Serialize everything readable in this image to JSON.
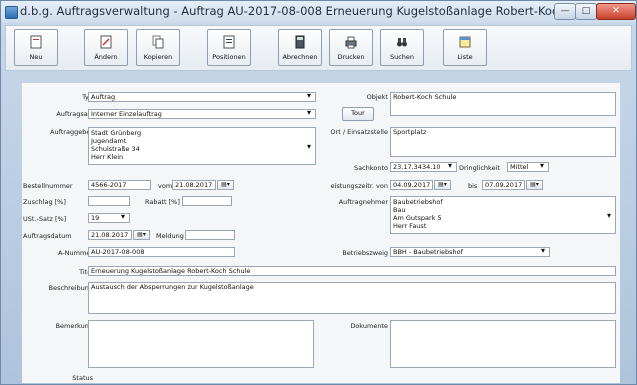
{
  "window": {
    "title": "d.b.g.  Auftragsverwaltung  -  Auftrag  AU-2017-08-008  Erneuerung Kugelstoßanlage Robert-Koch Schule",
    "btn_minimize": "—",
    "btn_maximize": "□",
    "btn_close": "✕"
  },
  "toolbar": {
    "buttons": [
      {
        "label": "Neu",
        "icon": "document-new-icon"
      },
      {
        "label": "Ändern",
        "icon": "document-edit-icon"
      },
      {
        "label": "Kopieren",
        "icon": "copy-icon"
      },
      {
        "label": "Positionen",
        "icon": "list-icon"
      },
      {
        "label": "Abrechnen",
        "icon": "calculator-icon"
      },
      {
        "label": "Drucken",
        "icon": "printer-icon"
      },
      {
        "label": "Suchen",
        "icon": "binoculars-icon"
      },
      {
        "label": "Liste",
        "icon": "table-icon"
      }
    ]
  },
  "form": {
    "typ": {
      "label": "Typ",
      "value": "Auftrag"
    },
    "auftragsart": {
      "label": "Auftragsart",
      "value": "Interner Einzelauftrag"
    },
    "auftraggeber": {
      "label": "Auftraggeber",
      "line1": "Stadt Grünberg",
      "line2": "Jugendamt",
      "line3": "Schulstraße 34",
      "line4": "Herr Klein"
    },
    "objekt": {
      "label": "Objekt",
      "value": "Robert-Koch Schule"
    },
    "tour": {
      "label": "Tour"
    },
    "ort": {
      "label": "Ort / Einsatzstelle",
      "value": "Sportplatz"
    },
    "sachkonto": {
      "label": "Sachkonto",
      "value": "23.17.3434.10"
    },
    "dringlichkeit": {
      "label": "Dringlichkeit",
      "value": "Mittel"
    },
    "bestellnummer": {
      "label": "Bestellnummer",
      "value": "4566-2017"
    },
    "vom": {
      "label": "vom",
      "value": "21.08.2017"
    },
    "leistungszeitraum": {
      "label": "eistungszeitr. von",
      "value": "04.09.2017"
    },
    "bis": {
      "label": "bis",
      "value": "07.09.2017"
    },
    "zuschlag": {
      "label": "Zuschlag [%]",
      "value": ""
    },
    "rabatt": {
      "label": "Rabatt [%]",
      "value": ""
    },
    "auftragnehmer": {
      "label": "Auftragnehmer",
      "line1": "Baubetriebshof",
      "line2": "Bau",
      "line3": "Am Gutspark 5",
      "line4": "Herr Faust"
    },
    "ust": {
      "label": "USt.-Satz [%]",
      "value": "19"
    },
    "auftragsdatum": {
      "label": "Auftragsdatum",
      "value": "21.08.2017"
    },
    "meldung": {
      "label": "Meldung",
      "value": ""
    },
    "anummer": {
      "label": "A-Nummer",
      "value": "AU-2017-08-008"
    },
    "betriebszweig": {
      "label": "Betriebszweig",
      "value": "BBH  -  Baubetriebshof"
    },
    "titel": {
      "label": "Titel",
      "value": "Erneuerung Kugelstoßanlage Robert-Koch Schule"
    },
    "beschreibung": {
      "label": "Beschreibung",
      "value": "Austausch der Absperrungen zur Kugelstoßanlage"
    },
    "bemerkung": {
      "label": "Bemerkung",
      "value": ""
    },
    "dokumente": {
      "label": "Dokumente",
      "value": ""
    },
    "status": {
      "label": "Status",
      "value": ""
    }
  }
}
